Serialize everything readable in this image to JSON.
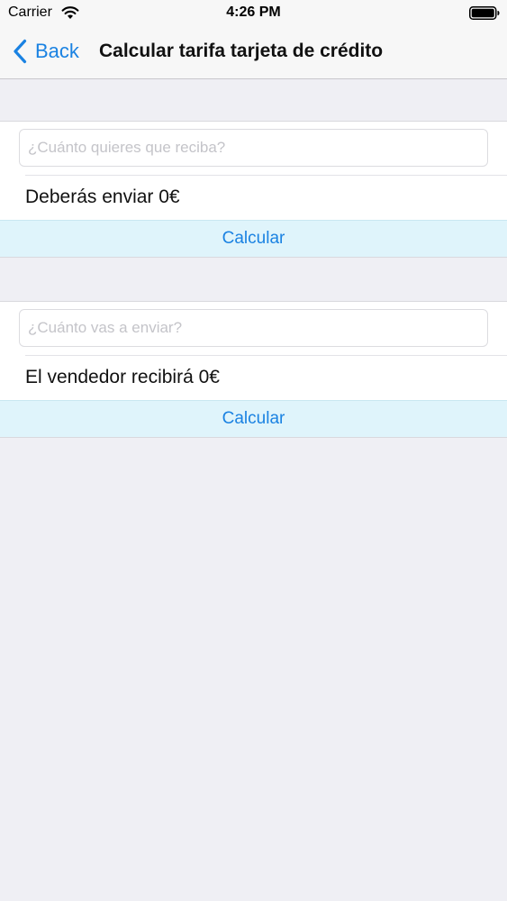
{
  "status_bar": {
    "carrier": "Carrier",
    "time": "4:26 PM",
    "wifi_icon": "wifi-icon",
    "battery_icon": "battery-full-icon"
  },
  "nav": {
    "back_label": "Back",
    "back_icon": "chevron-left-icon",
    "title": "Calcular tarifa tarjeta de crédito"
  },
  "sections": [
    {
      "input_placeholder": "¿Cuánto quieres que reciba?",
      "input_value": "",
      "result": "Deberás enviar 0€",
      "button_label": "Calcular"
    },
    {
      "input_placeholder": "¿Cuánto vas a enviar?",
      "input_value": "",
      "result": "El vendedor recibirá 0€",
      "button_label": "Calcular"
    }
  ],
  "colors": {
    "accent": "#1a82e2",
    "button_background": "#dff4fb",
    "page_background": "#efeff4"
  }
}
